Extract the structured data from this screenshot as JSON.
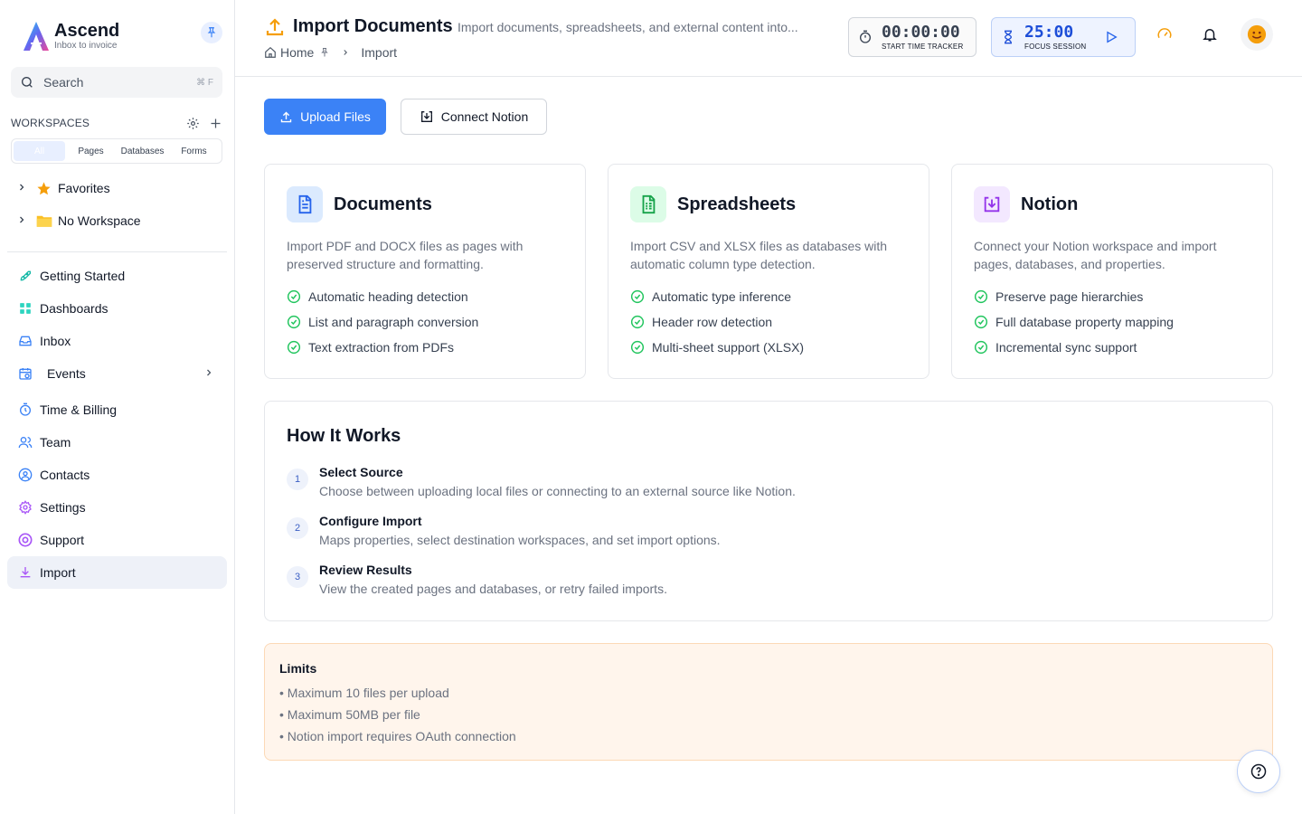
{
  "brand": {
    "name": "Ascend",
    "tagline": "Inbox to invoice"
  },
  "search": {
    "placeholder": "Search",
    "shortcut": "⌘ F"
  },
  "workspaces": {
    "title": "WORKSPACES",
    "tabs": [
      "All",
      "Pages",
      "Databases",
      "Forms"
    ],
    "tree": [
      {
        "label": "Favorites",
        "icon": "star-icon"
      },
      {
        "label": "No Workspace",
        "icon": "folder-icon"
      }
    ]
  },
  "nav": [
    {
      "label": "Getting Started",
      "icon": "rocket-icon"
    },
    {
      "label": "Dashboards",
      "icon": "grid-icon"
    },
    {
      "label": "Inbox",
      "icon": "inbox-icon"
    },
    {
      "label": "Events",
      "icon": "calendar-icon"
    },
    {
      "label": "Time & Billing",
      "icon": "stopwatch-icon"
    },
    {
      "label": "Team",
      "icon": "users-icon"
    },
    {
      "label": "Contacts",
      "icon": "contact-icon"
    },
    {
      "label": "Settings",
      "icon": "gear-icon"
    },
    {
      "label": "Support",
      "icon": "lifebuoy-icon"
    },
    {
      "label": "Import",
      "icon": "download-icon",
      "active": true
    }
  ],
  "header": {
    "title": "Import Documents",
    "subtitle": "Import documents, spreadsheets, and external content into...",
    "breadcrumb": [
      "Home",
      "Import"
    ]
  },
  "timers": {
    "tracker": {
      "value": "00:00:00",
      "label": "START TIME TRACKER"
    },
    "focus": {
      "value": "25:00",
      "label": "FOCUS SESSION"
    }
  },
  "actions": {
    "upload": "Upload Files",
    "connect": "Connect Notion"
  },
  "cards": [
    {
      "title": "Documents",
      "desc": "Import PDF and DOCX files as pages with preserved structure and formatting.",
      "features": [
        "Automatic heading detection",
        "List and paragraph conversion",
        "Text extraction from PDFs"
      ],
      "accent": "#2563eb"
    },
    {
      "title": "Spreadsheets",
      "desc": "Import CSV and XLSX files as databases with automatic column type detection.",
      "features": [
        "Automatic type inference",
        "Header row detection",
        "Multi-sheet support (XLSX)"
      ],
      "accent": "#16a34a"
    },
    {
      "title": "Notion",
      "desc": "Connect your Notion workspace and import pages, databases, and properties.",
      "features": [
        "Preserve page hierarchies",
        "Full database property mapping",
        "Incremental sync support"
      ],
      "accent": "#9333ea"
    }
  ],
  "how": {
    "title": "How It Works",
    "steps": [
      {
        "num": "1",
        "title": "Select Source",
        "desc": "Choose between uploading local files or connecting to an external source like Notion."
      },
      {
        "num": "2",
        "title": "Configure Import",
        "desc": "Maps properties, select destination workspaces, and set import options."
      },
      {
        "num": "3",
        "title": "Review Results",
        "desc": "View the created pages and databases, or retry failed imports."
      }
    ]
  },
  "limits": {
    "title": "Limits",
    "items": [
      "Maximum 10 files per upload",
      "Maximum 50MB per file",
      "Notion import requires OAuth connection"
    ]
  },
  "colors": {
    "primary": "#3b82f6",
    "success": "#22c55e",
    "warning_bg": "#fff5ec"
  }
}
